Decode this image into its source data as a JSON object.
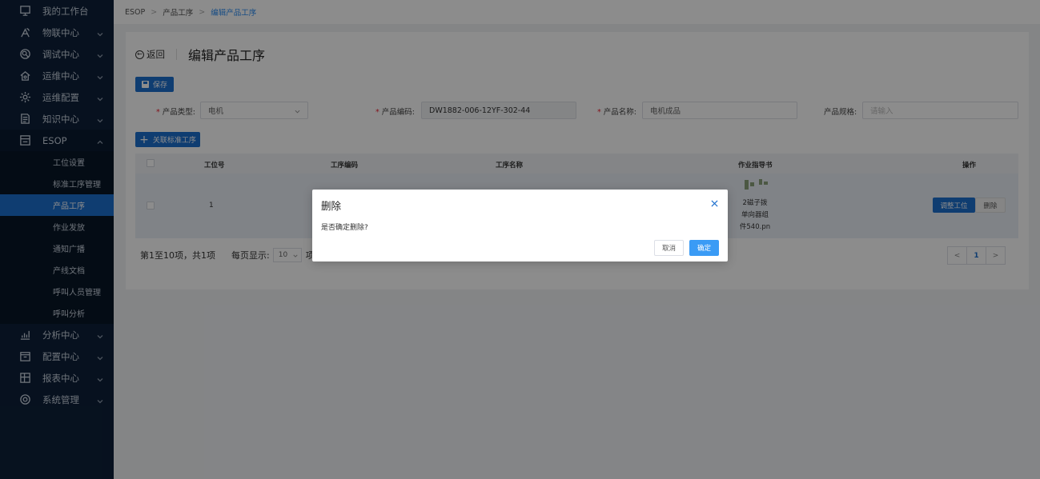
{
  "sidebar": {
    "items": [
      {
        "label": "我的工作台",
        "icon": "monitor-icon",
        "has_children": false
      },
      {
        "label": "物联中心",
        "icon": "antenna-icon",
        "has_children": true
      },
      {
        "label": "调试中心",
        "icon": "debug-icon",
        "has_children": true
      },
      {
        "label": "运维中心",
        "icon": "home-gear-icon",
        "has_children": true
      },
      {
        "label": "运维配置",
        "icon": "gear-icon",
        "has_children": true
      },
      {
        "label": "知识中心",
        "icon": "book-icon",
        "has_children": true
      },
      {
        "label": "ESOP",
        "icon": "esop-icon",
        "has_children": true,
        "open": true
      }
    ],
    "esop_children": [
      "工位设置",
      "标准工序管理",
      "产品工序",
      "作业发放",
      "通知广播",
      "产线文档",
      "呼叫人员管理",
      "呼叫分析"
    ],
    "esop_active": "产品工序",
    "items_after": [
      {
        "label": "分析中心",
        "icon": "chart-icon"
      },
      {
        "label": "配置中心",
        "icon": "config-icon"
      },
      {
        "label": "报表中心",
        "icon": "report-icon"
      },
      {
        "label": "系统管理",
        "icon": "settings-icon"
      }
    ]
  },
  "breadcrumb": {
    "root": "ESOP",
    "level2": "产品工序",
    "current": "编辑产品工序"
  },
  "header": {
    "back_label": "返回",
    "title": "编辑产品工序"
  },
  "toolbar": {
    "save_label": "保存",
    "link_label": "关联标准工序"
  },
  "form": {
    "product_type_label": "产品类型:",
    "product_type_value": "电机",
    "product_code_label": "产品编码:",
    "product_code_value": "DW1882-006-12YF-302-44",
    "product_name_label": "产品名称:",
    "product_name_value": "电机成品",
    "product_spec_label": "产品规格:",
    "product_spec_placeholder": "请输入"
  },
  "table": {
    "headers": {
      "station": "工位号",
      "code": "工序编码",
      "name": "工序名称",
      "guide": "作业指导书",
      "ops": "操作"
    },
    "rows": [
      {
        "station": "1",
        "doc_lines": [
          "2磁子拨",
          "单向器组",
          "件540.pn"
        ],
        "adjust_label": "调整工位",
        "delete_label": "删除"
      }
    ]
  },
  "pagination": {
    "summary": "第1至10项，共1项",
    "page_size_label": "每页显示:",
    "page_size": "10",
    "page_size_unit": "项",
    "prev": "<",
    "current_page": "1",
    "next": ">"
  },
  "modal": {
    "title": "删除",
    "message": "是否确定删除?",
    "cancel_label": "取消",
    "ok_label": "确定"
  },
  "colors": {
    "sidebar_bg": "#0d2039",
    "primary": "#1d6fce",
    "active_item": "#1d6fce",
    "modal_ok": "#3a9bf5"
  }
}
